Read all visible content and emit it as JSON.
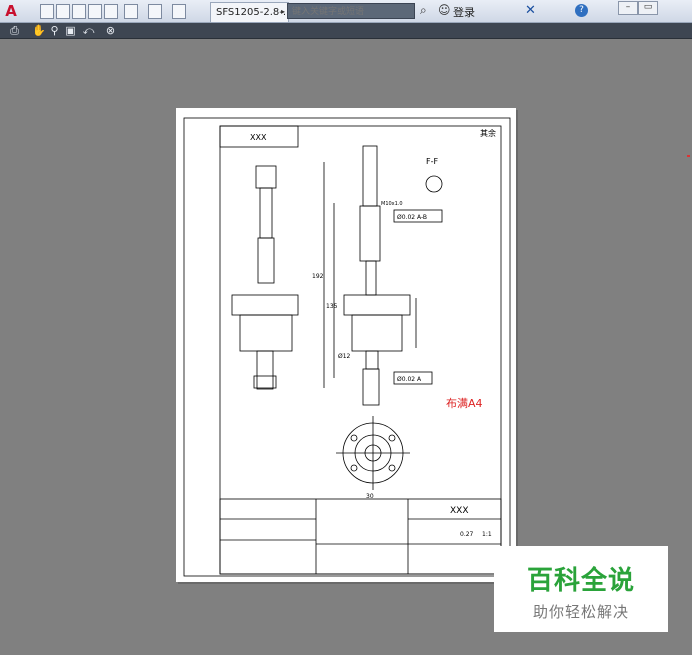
{
  "app": {
    "logo": "A"
  },
  "tabs": [
    {
      "label": "SFS1205-2.8-..."
    }
  ],
  "search": {
    "placeholder": "键入关键字或短语"
  },
  "account": {
    "login_label": "登录"
  },
  "help": {
    "label": "?"
  },
  "window_controls": {
    "minimize": "–",
    "restore": "▭"
  },
  "drawing": {
    "part_name": "XXX",
    "title_block_name": "XXX",
    "section_label": "F-F",
    "note_fill": "布满A4",
    "scale": "1:1",
    "weight": "0.27",
    "material": "Ø0.02 A-B",
    "tolerance_a": "Ø0.02 A",
    "dim_total": "192",
    "dim_mid": "135",
    "dim_shaft": "Ø12",
    "dim_bottom": "30",
    "dim_thread": "M10x1.0",
    "roughness": "其余"
  },
  "watermark": {
    "title": "百科全说",
    "subtitle": "助你轻松解决"
  }
}
